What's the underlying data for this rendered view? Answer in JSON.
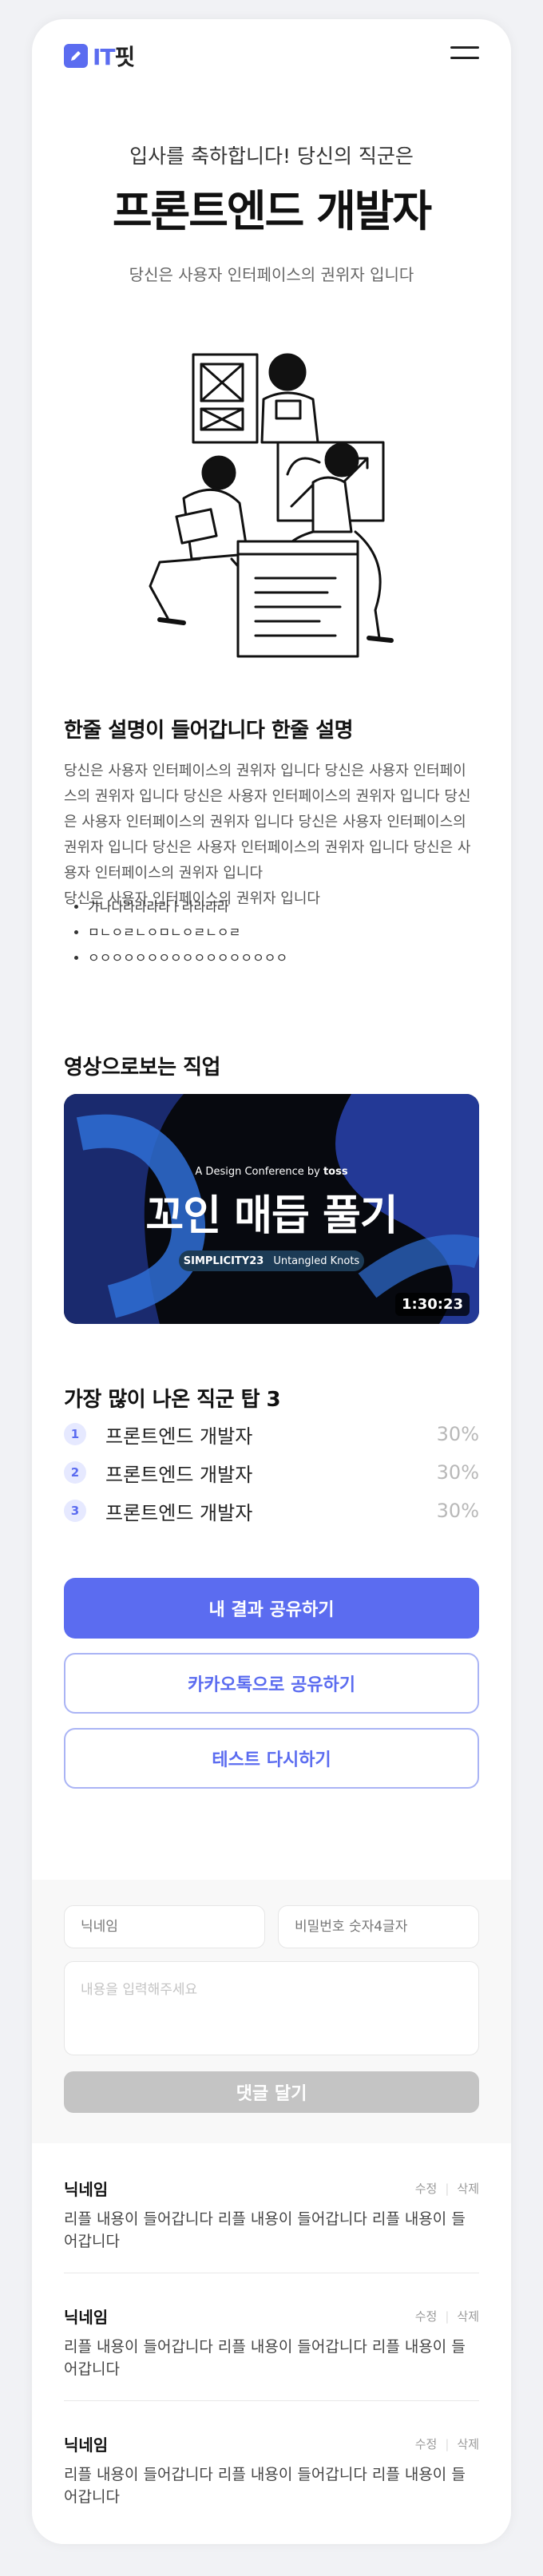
{
  "header": {
    "logo_it": "IT",
    "logo_suffix": "핏"
  },
  "hero": {
    "subtitle": "입사를 축하합니다! 당신의 직군은",
    "title": "프론트엔드 개발자",
    "description": "당신은 사용자 인터페이스의 권위자 입니다"
  },
  "summary": {
    "title": "한줄 설명이 들어갑니다 한줄 설명",
    "paragraph": "당신은 사용자 인터페이스의 권위자 입니다 당신은 사용자 인터페이스의 권위자 입니다 당신은 사용자 인터페이스의 권위자 입니다 당신은 사용자 인터페이스의 권위자 입니다 당신은 사용자 인터페이스의 권위자 입니다 당신은 사용자 인터페이스의 권위자 입니다 당신은 사용자 인터페이스의 권위자 입니다",
    "paragraph2": "당신은 사용자 인터페이스의 권위자 입니다",
    "bullets": [
      "가나다라라라라ㅏ라라라라",
      "ㅁㄴㅇㄹㄴㅇㅁㄴㅇㄹㄴㅇㄹ",
      "ㅇㅇㅇㅇㅇㅇㅇㅇㅇㅇㅇㅇㅇㅇㅇㅇㅇ"
    ]
  },
  "video_section": {
    "title": "영상으로보는 직업",
    "conference": "A Design Conference by",
    "brand": "toss",
    "video_title": "꼬인 매듭 풀기",
    "badge_main": "SIMPLICITY23",
    "badge_sub": "Untangled Knots",
    "duration": "1:30:23"
  },
  "top3": {
    "title": "가장 많이 나온 직군 탑 3",
    "items": [
      {
        "rank": "1",
        "name": "프론트엔드 개발자",
        "percent": "30%"
      },
      {
        "rank": "2",
        "name": "프론트엔드 개발자",
        "percent": "30%"
      },
      {
        "rank": "3",
        "name": "프론트엔드 개발자",
        "percent": "30%"
      }
    ]
  },
  "actions": {
    "share": "내 결과 공유하기",
    "kakao": "카카오톡으로 공유하기",
    "retry": "테스트 다시하기"
  },
  "comment_form": {
    "nickname_placeholder": "닉네임",
    "password_placeholder": "비밀번호 숫자4글자",
    "content_placeholder": "내용을 입력해주세요",
    "submit": "댓글 달기"
  },
  "comments": [
    {
      "nickname": "닉네임",
      "edit": "수정",
      "delete": "삭제",
      "text": "리플 내용이 들어갑니다 리플 내용이 들어갑니다 리플 내용이 들어갑니다"
    },
    {
      "nickname": "닉네임",
      "edit": "수정",
      "delete": "삭제",
      "text": "리플 내용이 들어갑니다 리플 내용이 들어갑니다 리플 내용이 들어갑니다"
    },
    {
      "nickname": "닉네임",
      "edit": "수정",
      "delete": "삭제",
      "text": "리플 내용이 들어갑니다 리플 내용이 들어갑니다 리플 내용이 들어갑니다"
    }
  ],
  "colors": {
    "accent": "#5b6cf0",
    "disabled": "#c4c4c4"
  }
}
